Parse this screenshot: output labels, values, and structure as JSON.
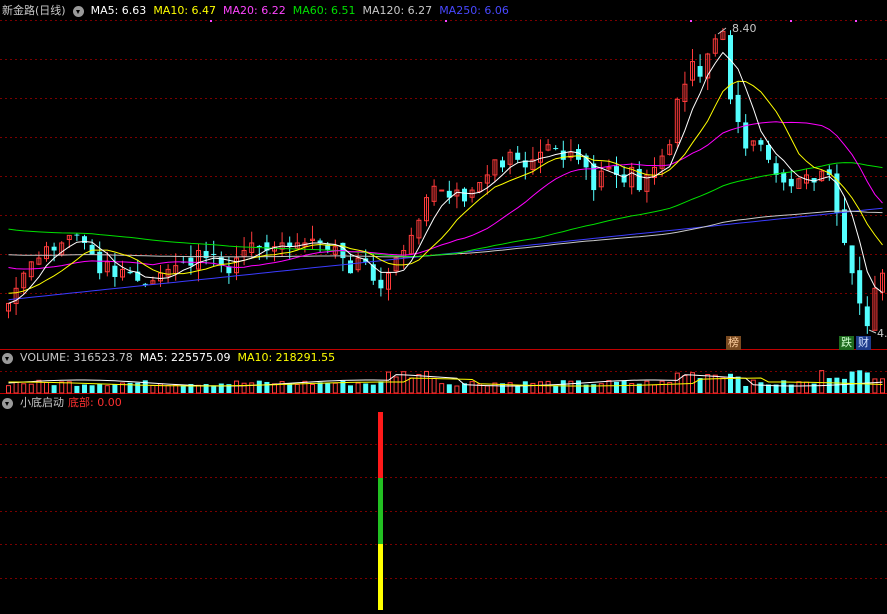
{
  "header": {
    "stock_name": "新金路(日线)",
    "ma5": "MA5: 6.63",
    "ma10": "MA10: 6.47",
    "ma20": "MA20: 6.22",
    "ma60": "MA60: 6.51",
    "ma120": "MA120: 6.27",
    "ma250": "MA250: 6.06"
  },
  "volume_header": {
    "volume": "VOLUME: 316523.78",
    "ma5": "MA5: 225575.09",
    "ma10": "MA10: 218291.55"
  },
  "indicator_header": {
    "name": "小底启动",
    "value": "底部: 0.00"
  },
  "annotations": {
    "high_price": "8.40",
    "low_price": "4.",
    "tag_bang": "榜",
    "tag_die": "跌",
    "tag_cai": "财"
  },
  "colors": {
    "background": "#000000",
    "up": "#ff3b3b",
    "down": "#54ffff",
    "ma5": "#ffffff",
    "ma10": "#ffff00",
    "ma20": "#ff00ff",
    "ma60": "#00e000",
    "ma120": "#c8c8c8",
    "ma250": "#3b3bff",
    "grid": "#7a0000"
  },
  "chart_data": [
    {
      "type": "candlestick",
      "title": "新金路(日线)",
      "series": [
        {
          "name": "MA5",
          "value": 6.63
        },
        {
          "name": "MA10",
          "value": 6.47
        },
        {
          "name": "MA20",
          "value": 6.22
        },
        {
          "name": "MA60",
          "value": 6.51
        },
        {
          "name": "MA120",
          "value": 6.27
        },
        {
          "name": "MA250",
          "value": 6.06
        }
      ],
      "ylim": [
        4.25,
        8.55
      ],
      "closes": [
        4.8,
        5.0,
        5.2,
        5.35,
        5.4,
        5.55,
        5.5,
        5.6,
        5.7,
        5.7,
        5.6,
        5.45,
        5.2,
        5.35,
        5.15,
        5.25,
        5.2,
        5.1,
        5.05,
        5.1,
        5.2,
        5.25,
        5.3,
        5.35,
        5.3,
        5.5,
        5.4,
        5.45,
        5.3,
        5.2,
        5.4,
        5.5,
        5.6,
        5.55,
        5.5,
        5.55,
        5.6,
        5.55,
        5.6,
        5.6,
        5.65,
        5.6,
        5.5,
        5.55,
        5.4,
        5.2,
        5.4,
        5.35,
        5.1,
        5.0,
        5.2,
        5.4,
        5.5,
        5.7,
        5.9,
        6.2,
        6.35,
        6.3,
        6.2,
        6.3,
        6.15,
        6.3,
        6.4,
        6.5,
        6.7,
        6.6,
        6.8,
        6.7,
        6.6,
        6.7,
        6.8,
        6.9,
        6.85,
        6.7,
        6.8,
        6.7,
        6.6,
        6.3,
        6.55,
        6.6,
        6.5,
        6.4,
        6.6,
        6.3,
        6.5,
        6.6,
        6.75,
        6.9,
        7.5,
        7.7,
        8.0,
        7.8,
        8.1,
        8.3,
        8.4,
        7.5,
        7.2,
        6.85,
        6.95,
        6.9,
        6.7,
        6.5,
        6.4,
        6.35,
        6.45,
        6.5,
        6.4,
        6.55,
        6.5,
        6.0,
        5.6,
        5.2,
        4.8,
        4.5,
        5.0,
        5.2
      ]
    },
    {
      "type": "bar",
      "title": "VOLUME",
      "series": [
        {
          "name": "VOLUME",
          "value": 316523.78
        },
        {
          "name": "MA5",
          "value": 225575.09
        },
        {
          "name": "MA10",
          "value": 218291.55
        }
      ]
    },
    {
      "type": "bar",
      "title": "小底启动",
      "series": [
        {
          "name": "底部",
          "value": 0.0
        }
      ]
    }
  ]
}
